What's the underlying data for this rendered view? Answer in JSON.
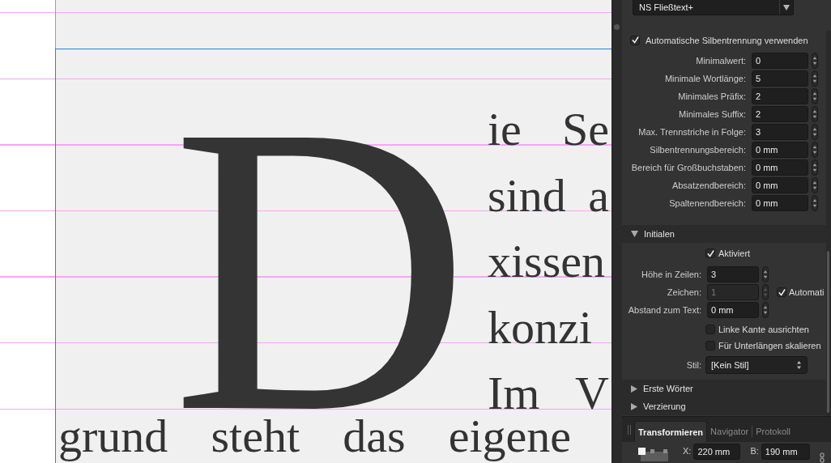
{
  "document": {
    "drop_cap": "D",
    "lines": [
      "ie Se",
      "sind a",
      "xissen",
      "konzi",
      "Im V"
    ],
    "last_line": "grund steht das eigene"
  },
  "panel": {
    "style_dropdown": {
      "value": "NS Fließtext+"
    },
    "hyphenation": {
      "label": "Automatische Silbentrennung verwenden",
      "checked": true,
      "fields": [
        {
          "label": "Minimalwert:",
          "value": "0"
        },
        {
          "label": "Minimale Wortlänge:",
          "value": "5"
        },
        {
          "label": "Minimales Präfix:",
          "value": "2"
        },
        {
          "label": "Minimales Suffix:",
          "value": "2"
        },
        {
          "label": "Max. Trennstriche in Folge:",
          "value": "3"
        },
        {
          "label": "Silbentrennungsbereich:",
          "value": "0 mm"
        },
        {
          "label": "Bereich für Großbuchstaben:",
          "value": "0 mm"
        },
        {
          "label": "Absatzendbereich:",
          "value": "0 mm"
        },
        {
          "label": "Spaltenendbereich:",
          "value": "0 mm"
        }
      ]
    },
    "sections": [
      {
        "title": "Initialen",
        "expanded": true,
        "controls": [
          {
            "kind": "checkbox",
            "label": "Aktiviert",
            "checked": true,
            "disabled": false
          },
          {
            "kind": "number",
            "label": "Höhe in Zeilen:",
            "value": "3",
            "disabled": false
          },
          {
            "kind": "number",
            "label": "Zeichen:",
            "value": "1",
            "disabled": true,
            "option": {
              "label": "Automati",
              "checked": true
            }
          },
          {
            "kind": "number",
            "label": "Abstand zum Text:",
            "value": "0 mm",
            "disabled": false
          },
          {
            "kind": "checkbox",
            "label": "Linke Kante ausrichten",
            "checked": false,
            "disabled": false
          },
          {
            "kind": "checkbox",
            "label": "Für Unterlängen skalieren",
            "checked": false,
            "disabled": false
          },
          {
            "kind": "select",
            "label": "Stil:",
            "value": "[Kein Stil]",
            "disabled": false
          }
        ]
      },
      {
        "title": "Erste Wörter",
        "expanded": false
      },
      {
        "title": "Verzierung",
        "expanded": false
      }
    ],
    "tabs": [
      {
        "label": "Transformieren",
        "selected": true
      },
      {
        "label": "Navigator",
        "selected": false
      },
      {
        "label": "Protokoll",
        "selected": false
      }
    ],
    "transform": {
      "fields": [
        {
          "label": "X:",
          "value": "220 mm"
        },
        {
          "label": "B:",
          "value": "190 mm"
        }
      ]
    }
  }
}
